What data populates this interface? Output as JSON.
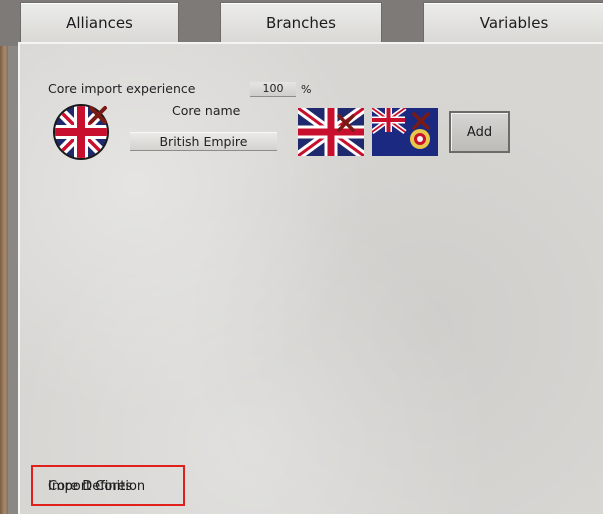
{
  "tabs": [
    {
      "label": "Alliances"
    },
    {
      "label": "Branches"
    },
    {
      "label": "Variables"
    }
  ],
  "core_import": {
    "label": "Core import experience",
    "value": "100",
    "unit": "%"
  },
  "core_name": {
    "label": "Core name",
    "value": "British Empire"
  },
  "add_button": {
    "label": "Add"
  },
  "bottom_overlap": {
    "text_a": "Import Cores",
    "text_b": "Core Definition"
  },
  "colors": {
    "union_blue": "#1f2a6e",
    "union_red": "#c8102e",
    "highlight": "#e0201c"
  },
  "icons": [
    "union-jack-round-icon",
    "remove-x-icon",
    "union-jack-flag-icon",
    "blue-ensign-flag-icon"
  ]
}
